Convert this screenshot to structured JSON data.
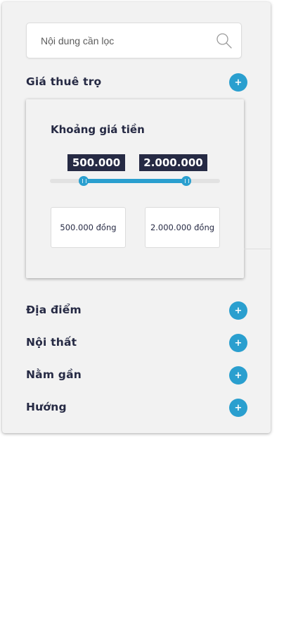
{
  "search": {
    "placeholder": "Nội dung cần lọc"
  },
  "price_section": {
    "title": "Giá thuê trọ",
    "toggle_label": "+",
    "range_title": "Khoảng giá tiền",
    "min_tag": "500.000",
    "max_tag": "2.000.000",
    "slider_min_fraction": 0.2,
    "slider_max_fraction": 0.8,
    "min_input": "500.000 đồng",
    "max_input": "2.000.000 đồng"
  },
  "sections": [
    {
      "title": "Địa điểm",
      "toggle_label": "+"
    },
    {
      "title": "Nội thất",
      "toggle_label": "+"
    },
    {
      "title": "Nằm gần",
      "toggle_label": "+"
    },
    {
      "title": "Hướng",
      "toggle_label": "+"
    }
  ],
  "colors": {
    "accent": "#2a9fcf",
    "dark": "#262a44",
    "panel": "#f2f2f2"
  }
}
